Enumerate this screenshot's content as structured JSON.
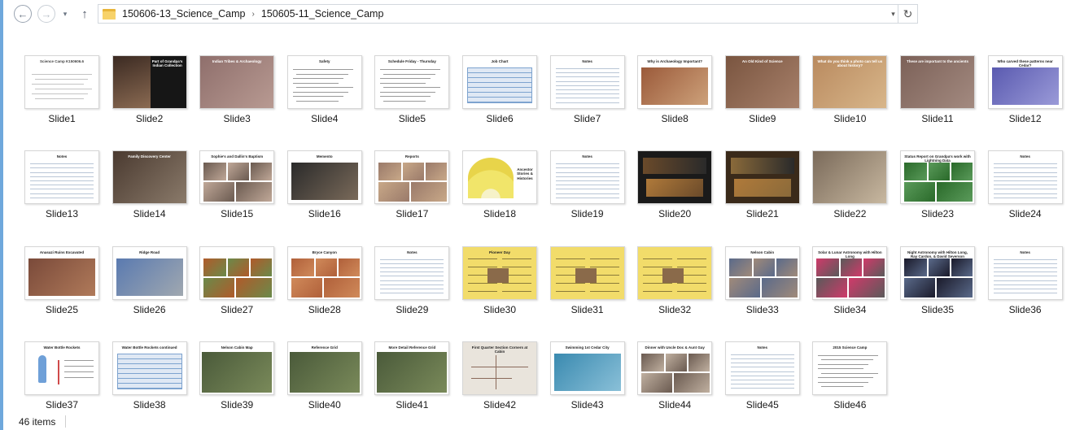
{
  "nav": {
    "back_glyph": "←",
    "forward_glyph": "→",
    "recent_glyph": "▾",
    "up_glyph": "↑",
    "refresh_glyph": "↻",
    "dropdown_glyph": "▾",
    "crumb_sep_glyph": "›",
    "breadcrumb": [
      "150606-13_Science_Camp",
      "150605-11_Science_Camp"
    ]
  },
  "icons": {
    "back": "back-arrow-icon",
    "forward": "forward-arrow-icon",
    "recent": "chevron-down-icon",
    "up": "up-arrow-icon",
    "folder": "folder-icon",
    "refresh": "refresh-icon"
  },
  "colors": {
    "accent": "#6fa8dc",
    "folder": "#f7d26a"
  },
  "files": [
    {
      "label": "Slide1",
      "style": "plaintext",
      "title": "Science Camp K150606.6"
    },
    {
      "label": "Slide2",
      "style": "photo-left",
      "title": "Part of Grandpa's Indian Collection",
      "c1": "#3b2a22",
      "c2": "#8a6a52"
    },
    {
      "label": "Slide3",
      "style": "photo-full",
      "title": "Indian Tribes & Archaeology",
      "c1": "#8f6f6c",
      "c2": "#b89a92"
    },
    {
      "label": "Slide4",
      "style": "bullets",
      "title": "Safety"
    },
    {
      "label": "Slide5",
      "style": "bullets",
      "title": "Schedule Friday - Thursday"
    },
    {
      "label": "Slide6",
      "style": "table",
      "title": "Job Chart"
    },
    {
      "label": "Slide7",
      "style": "notes",
      "title": "Notes"
    },
    {
      "label": "Slide8",
      "style": "title-photo",
      "title": "Why is Archaeology Important?",
      "c1": "#9b5a3a",
      "c2": "#cda17a"
    },
    {
      "label": "Slide9",
      "style": "photo-full",
      "title": "An Old Kind of Science",
      "c1": "#7a5540",
      "c2": "#a7806a"
    },
    {
      "label": "Slide10",
      "style": "photo-full",
      "title": "What do you think a photo can tell us about history?",
      "c1": "#b98a5f",
      "c2": "#d8b68a"
    },
    {
      "label": "Slide11",
      "style": "photo-full",
      "title": "These are important to the ancients",
      "c1": "#7c6158",
      "c2": "#a38a80"
    },
    {
      "label": "Slide12",
      "style": "title-photo",
      "title": "Who carved these patterns near Cedar?",
      "c1": "#5a5ab0",
      "c2": "#9a9ad8"
    },
    {
      "label": "Slide13",
      "style": "notes",
      "title": "Notes"
    },
    {
      "label": "Slide14",
      "style": "photo-full",
      "title": "Family Discovery Center",
      "c1": "#4a3a30",
      "c2": "#8a7a6a"
    },
    {
      "label": "Slide15",
      "style": "collage-light",
      "title": "Sophie's and Dallin's Baptism",
      "c1": "#6a5a50",
      "c2": "#c0a898"
    },
    {
      "label": "Slide16",
      "style": "title-photo",
      "title": "Memento",
      "c1": "#2a2a2a",
      "c2": "#7a6a5a"
    },
    {
      "label": "Slide17",
      "style": "collage-light",
      "title": "Reports",
      "c1": "#9a7a6a",
      "c2": "#c8a888"
    },
    {
      "label": "Slide18",
      "style": "fan",
      "title": "Ancestor Stories & Histories"
    },
    {
      "label": "Slide19",
      "style": "notes",
      "title": "Notes"
    },
    {
      "label": "Slide20",
      "style": "dark",
      "title": "",
      "c1": "#1a1a1a",
      "c2": "#6a4a2a"
    },
    {
      "label": "Slide21",
      "style": "dark",
      "title": "",
      "c1": "#3a2a1a",
      "c2": "#8a6a3a"
    },
    {
      "label": "Slide22",
      "style": "photo-full",
      "title": "",
      "c1": "#7a6a5a",
      "c2": "#c8b8a0"
    },
    {
      "label": "Slide23",
      "style": "collage-light",
      "title": "Status Report on Grandpa's work with Lightning Data",
      "c1": "#2a6a2a",
      "c2": "#5a9a5a"
    },
    {
      "label": "Slide24",
      "style": "notes",
      "title": "Notes"
    },
    {
      "label": "Slide25",
      "style": "title-photo",
      "title": "Anasazi Ruins Excavated",
      "c1": "#7a4a3a",
      "c2": "#b07a5a"
    },
    {
      "label": "Slide26",
      "style": "title-photo",
      "title": "Ridge Road",
      "c1": "#5a7ab0",
      "c2": "#a0a8b0"
    },
    {
      "label": "Slide27",
      "style": "collage-light",
      "title": "",
      "c1": "#b05a2a",
      "c2": "#6a8a4a"
    },
    {
      "label": "Slide28",
      "style": "collage-light",
      "title": "Bryce Canyon",
      "c1": "#b0603a",
      "c2": "#d08a5a"
    },
    {
      "label": "Slide29",
      "style": "notes",
      "title": "Notes"
    },
    {
      "label": "Slide30",
      "style": "yellow",
      "title": "Pioneer Day"
    },
    {
      "label": "Slide31",
      "style": "yellow",
      "title": ""
    },
    {
      "label": "Slide32",
      "style": "yellow",
      "title": ""
    },
    {
      "label": "Slide33",
      "style": "collage-light",
      "title": "Nelson Cabin",
      "c1": "#5a6a8a",
      "c2": "#a08a7a"
    },
    {
      "label": "Slide34",
      "style": "collage-light",
      "title": "Solar & Lunar Astronomy with Hilton Long",
      "c1": "#d03a6a",
      "c2": "#5a5a5a"
    },
    {
      "label": "Slide35",
      "style": "collage-light",
      "title": "Night Astronomy with Hilton Long, Ray Cardon, & David Severson",
      "c1": "#1a1a2a",
      "c2": "#5a6a8a"
    },
    {
      "label": "Slide36",
      "style": "notes",
      "title": "Notes"
    },
    {
      "label": "Slide37",
      "style": "rocket",
      "title": "Water Bottle Rockets"
    },
    {
      "label": "Slide38",
      "style": "table",
      "title": "Water Bottle Rockets continued"
    },
    {
      "label": "Slide39",
      "style": "map",
      "title": "Nelson Cabin Map"
    },
    {
      "label": "Slide40",
      "style": "map",
      "title": "Reference Grid"
    },
    {
      "label": "Slide41",
      "style": "map",
      "title": "More Detail Reference Grid"
    },
    {
      "label": "Slide42",
      "style": "lines-map",
      "title": "First Quarter Section Corners at Cabin"
    },
    {
      "label": "Slide43",
      "style": "title-photo",
      "title": "Swimming 1st Cedar City",
      "c1": "#3a8ab0",
      "c2": "#8ac0d8"
    },
    {
      "label": "Slide44",
      "style": "collage-light",
      "title": "Dinner with Uncle Doc & Aunt Gay",
      "c1": "#6a5a50",
      "c2": "#c0b0a0"
    },
    {
      "label": "Slide45",
      "style": "notes",
      "title": "Notes"
    },
    {
      "label": "Slide46",
      "style": "bullets",
      "title": "2015 Science Camp"
    }
  ],
  "status": {
    "count": "46 items"
  }
}
